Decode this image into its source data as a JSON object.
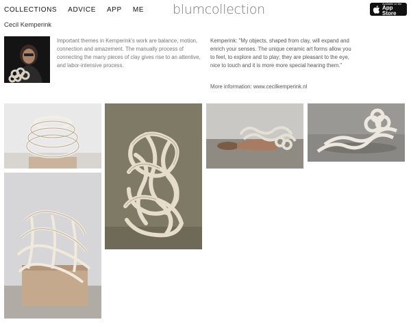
{
  "nav": {
    "items": [
      "COLLECTIONS",
      "ADVICE",
      "APP",
      "ME"
    ]
  },
  "logo": "blumcollection",
  "appstore": {
    "line1": "Available on the",
    "line2": "App Store"
  },
  "artist": {
    "name": "Cecil Kemperink",
    "bio": "Important themes in Kemperink's work are balance, motion, connection and amazement. The manually process of connecting the many pieces of clay gives rise to an attentive, and labor-intensive process.",
    "quote": "Kemperink: \"My objects, shaped from clay, will expand and enrich your senses. The unique ceramic art forms allow you to feel, to explore and to play; they are pleasant to the eye, nice to touch and it is more more special hearing them.\"",
    "more_label": "More information:",
    "more_link": "www.cecilkemperink.nl"
  },
  "gallery": {
    "images": [
      {
        "name": "chain-vessel-photo"
      },
      {
        "name": "tangled-coil-sculpture-photo"
      },
      {
        "name": "reclining-figure-with-coils-photo"
      },
      {
        "name": "braided-coil-on-floor-photo"
      },
      {
        "name": "chain-draped-on-plinth-photo"
      }
    ]
  },
  "colors": {
    "background": "#ffffff",
    "nav_text": "#111111",
    "logo": "#777777",
    "body_text": "#777777",
    "appstore_bg": "#111111"
  }
}
